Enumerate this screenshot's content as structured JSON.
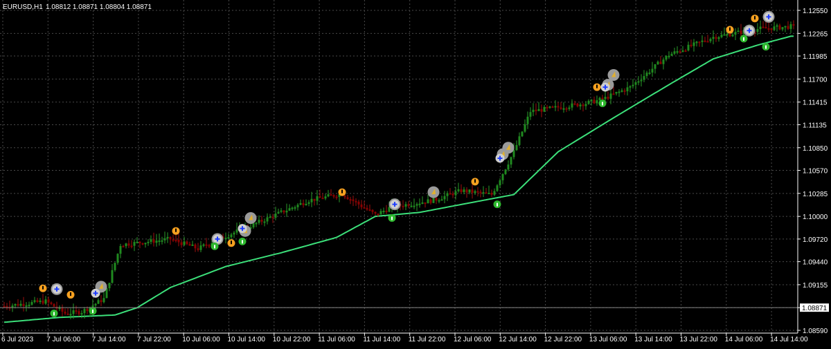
{
  "header": {
    "symbol_tf": "EURUSD,H1",
    "ohlc": "1.08812 1.08871 1.08804 1.08871"
  },
  "current_price": {
    "label": "1.08871",
    "value": 1.08871
  },
  "colors": {
    "background": "#000000",
    "grid": "#4a4a4a",
    "bull_candle": "#1f8a1f",
    "bear_candle": "#8b0000",
    "ma_line": "#3ce07a",
    "signal_orange": "#f5a020",
    "signal_green": "#2eb82e",
    "signal_grey": "#9a9a9a",
    "signal_blue": "#1e3cff"
  },
  "chart_data": {
    "type": "candlestick",
    "y_axis": {
      "ticks": [
        "1.12550",
        "1.12265",
        "1.11985",
        "1.11700",
        "1.11415",
        "1.11135",
        "1.10850",
        "1.10570",
        "1.10285",
        "1.10000",
        "1.09720",
        "1.09440",
        "1.09155",
        "1.08871",
        "1.08590"
      ],
      "range": [
        1.0859,
        1.1255
      ]
    },
    "x_axis": {
      "ticks": [
        "6 Jul 2023",
        "7 Jul 06:00",
        "7 Jul 14:00",
        "7 Jul 22:00",
        "10 Jul 06:00",
        "10 Jul 14:00",
        "10 Jul 22:00",
        "11 Jul 06:00",
        "11 Jul 14:00",
        "11 Jul 22:00",
        "12 Jul 06:00",
        "12 Jul 14:00",
        "12 Jul 22:00",
        "13 Jul 06:00",
        "13 Jul 14:00",
        "13 Jul 22:00",
        "14 Jul 06:00",
        "14 Jul 14:00"
      ]
    },
    "moving_average_anchors": [
      [
        0,
        1.0869
      ],
      [
        20,
        1.0875
      ],
      [
        40,
        1.0878
      ],
      [
        48,
        1.0887
      ],
      [
        60,
        1.0912
      ],
      [
        80,
        1.0938
      ],
      [
        100,
        1.0955
      ],
      [
        120,
        1.0974
      ],
      [
        134,
        1.1
      ],
      [
        150,
        1.1005
      ],
      [
        170,
        1.1018
      ],
      [
        184,
        1.1027
      ],
      [
        200,
        1.108
      ],
      [
        220,
        1.1122
      ],
      [
        240,
        1.1163
      ],
      [
        256,
        1.1195
      ],
      [
        272,
        1.1212
      ],
      [
        284,
        1.1223
      ]
    ],
    "price_anchors": [
      [
        0,
        1.0889
      ],
      [
        15,
        1.0895
      ],
      [
        22,
        1.088
      ],
      [
        28,
        1.0882
      ],
      [
        36,
        1.0898
      ],
      [
        42,
        1.0965
      ],
      [
        60,
        1.0972
      ],
      [
        70,
        1.096
      ],
      [
        76,
        1.097
      ],
      [
        90,
        1.099
      ],
      [
        110,
        1.102
      ],
      [
        122,
        1.1028
      ],
      [
        134,
        1.1002
      ],
      [
        140,
        1.1012
      ],
      [
        155,
        1.102
      ],
      [
        165,
        1.1032
      ],
      [
        176,
        1.1027
      ],
      [
        178,
        1.104
      ],
      [
        184,
        1.108
      ],
      [
        190,
        1.113
      ],
      [
        210,
        1.114
      ],
      [
        216,
        1.1145
      ],
      [
        226,
        1.116
      ],
      [
        240,
        1.12
      ],
      [
        256,
        1.1222
      ],
      [
        272,
        1.1232
      ],
      [
        284,
        1.1235
      ]
    ],
    "signals": [
      {
        "kind": "orange",
        "bar": 14,
        "price": 1.0911
      },
      {
        "kind": "grey",
        "bar": 19,
        "price": 1.091
      },
      {
        "kind": "blue",
        "bar": 19,
        "price": 1.091
      },
      {
        "kind": "green",
        "bar": 18,
        "price": 1.088
      },
      {
        "kind": "orange",
        "bar": 24,
        "price": 1.0903
      },
      {
        "kind": "grey",
        "bar": 35,
        "price": 1.0913
      },
      {
        "kind": "blue",
        "bar": 33,
        "price": 1.0905
      },
      {
        "kind": "green",
        "bar": 32,
        "price": 1.0883
      },
      {
        "kind": "orange",
        "bar": 62,
        "price": 1.0982
      },
      {
        "kind": "grey",
        "bar": 77,
        "price": 1.0972
      },
      {
        "kind": "blue",
        "bar": 77,
        "price": 1.0972
      },
      {
        "kind": "green",
        "bar": 76,
        "price": 1.0963
      },
      {
        "kind": "orange",
        "bar": 82,
        "price": 1.0967
      },
      {
        "kind": "grey",
        "bar": 87,
        "price": 1.0982
      },
      {
        "kind": "grey",
        "bar": 89,
        "price": 1.0998
      },
      {
        "kind": "blue",
        "bar": 86,
        "price": 1.0985
      },
      {
        "kind": "green",
        "bar": 86,
        "price": 1.0969
      },
      {
        "kind": "orange",
        "bar": 122,
        "price": 1.103
      },
      {
        "kind": "grey",
        "bar": 141,
        "price": 1.1015
      },
      {
        "kind": "blue",
        "bar": 141,
        "price": 1.1015
      },
      {
        "kind": "green",
        "bar": 140,
        "price": 1.0998
      },
      {
        "kind": "grey",
        "bar": 155,
        "price": 1.103
      },
      {
        "kind": "orange",
        "bar": 170,
        "price": 1.1043
      },
      {
        "kind": "green",
        "bar": 178,
        "price": 1.1015
      },
      {
        "kind": "grey",
        "bar": 180,
        "price": 1.1077
      },
      {
        "kind": "grey",
        "bar": 182,
        "price": 1.1085
      },
      {
        "kind": "blue",
        "bar": 179,
        "price": 1.1072
      },
      {
        "kind": "orange",
        "bar": 214,
        "price": 1.116
      },
      {
        "kind": "grey",
        "bar": 218,
        "price": 1.1163
      },
      {
        "kind": "grey",
        "bar": 220,
        "price": 1.1175
      },
      {
        "kind": "blue",
        "bar": 217,
        "price": 1.116
      },
      {
        "kind": "green",
        "bar": 216,
        "price": 1.114
      },
      {
        "kind": "orange",
        "bar": 262,
        "price": 1.1231
      },
      {
        "kind": "orange",
        "bar": 271,
        "price": 1.1245
      },
      {
        "kind": "grey",
        "bar": 269,
        "price": 1.123
      },
      {
        "kind": "blue",
        "bar": 269,
        "price": 1.123
      },
      {
        "kind": "green",
        "bar": 267,
        "price": 1.122
      },
      {
        "kind": "grey",
        "bar": 276,
        "price": 1.1247
      },
      {
        "kind": "blue",
        "bar": 276,
        "price": 1.1247
      },
      {
        "kind": "green",
        "bar": 275,
        "price": 1.121
      }
    ]
  }
}
